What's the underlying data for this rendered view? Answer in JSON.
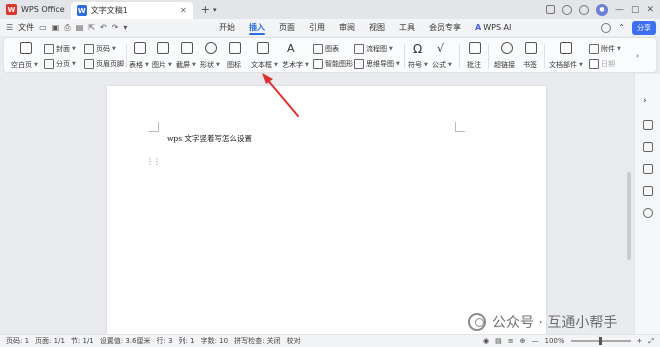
{
  "titlebar": {
    "app_name": "WPS Office",
    "doc_tab": "文字文稿1",
    "new_tab": "+",
    "new_tab_menu": "▾",
    "right_icons": [
      "monitor-icon",
      "box-icon",
      "settings-icon",
      "avatar-icon",
      "minimize-icon",
      "maximize-icon",
      "close-icon"
    ]
  },
  "menubar": {
    "file": "文件",
    "tabs": [
      "开始",
      "插入",
      "页面",
      "引用",
      "审阅",
      "视图",
      "工具",
      "会员专享"
    ],
    "active_tab": "插入",
    "wps_ai": "WPS AI",
    "share": "分享"
  },
  "ribbon": {
    "blank_page": "空白页",
    "cover": "封面",
    "page_break": "分页",
    "page_number": "页码",
    "header_footer": "页眉页脚",
    "table": "表格",
    "picture": "图片",
    "screenshot": "截屏",
    "shapes": "形状",
    "icons": "图标",
    "textbox": "文本框",
    "wordart": "艺术字",
    "chart": "图表",
    "flowchart": "流程图",
    "smart_shape": "智能图形",
    "mindmap": "思维导图",
    "symbol": "符号",
    "formula": "公式",
    "comment": "批注",
    "hyperlink": "超链接",
    "bookmark": "书签",
    "doc_parts": "文档部件",
    "attachment": "附件",
    "date": "日期",
    "more": "更多"
  },
  "document": {
    "text": "wps 文字竖着写怎么设置"
  },
  "statusbar": {
    "page": "页码: 1",
    "pages": "页面: 1/1",
    "section": "节: 1/1",
    "position": "设置值: 3.6厘米",
    "line": "行: 3",
    "column": "列: 1",
    "word_count": "字数: 10",
    "spell_check": "拼写检查: 关闭",
    "proofread": "校对",
    "zoom": "100%"
  },
  "watermark": {
    "text": "公众号 · 互通小帮手"
  },
  "colors": {
    "accent": "#2d6cdf",
    "arrow": "#e03131",
    "wps_red": "#e0342c"
  }
}
